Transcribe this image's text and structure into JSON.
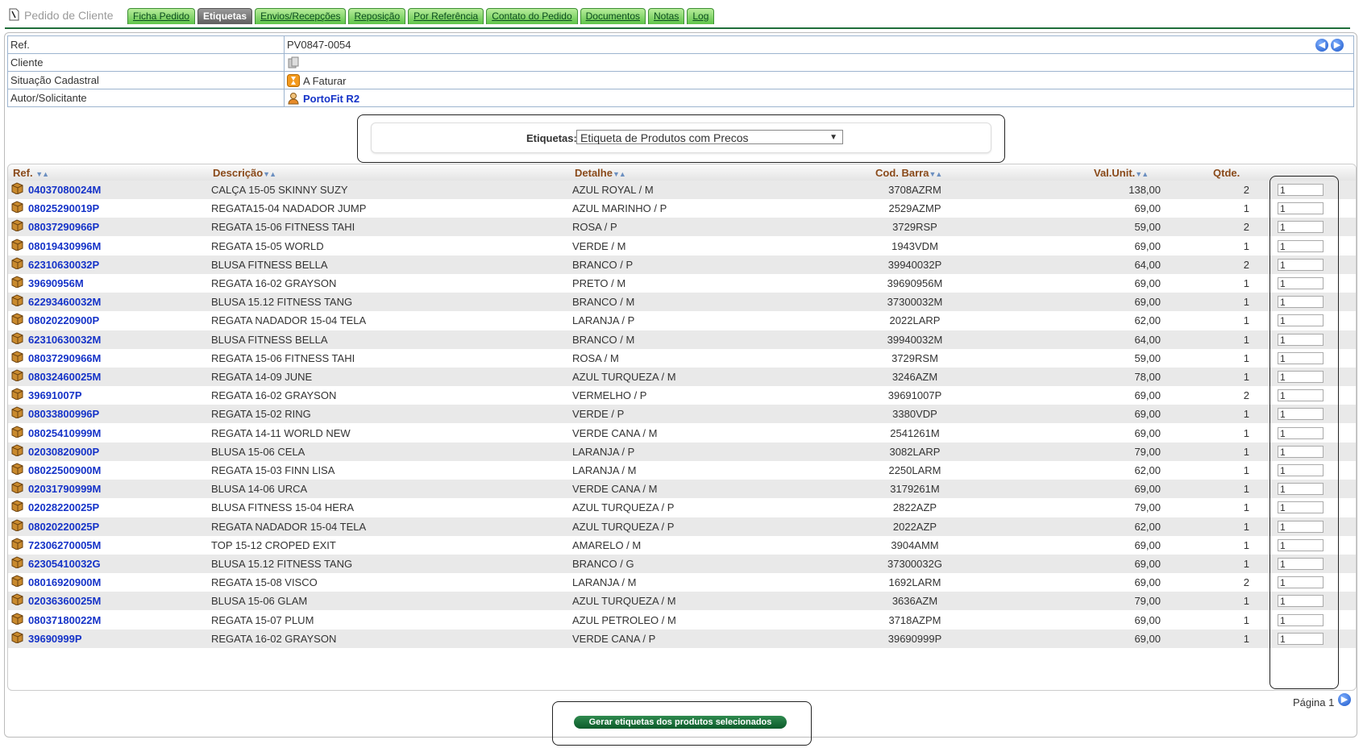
{
  "app": {
    "title": "Pedido de Cliente"
  },
  "tabs": [
    {
      "label": "Ficha Pedido",
      "active": false
    },
    {
      "label": "Etiquetas",
      "active": true
    },
    {
      "label": "Envios/Recepções",
      "active": false
    },
    {
      "label": "Reposição",
      "active": false
    },
    {
      "label": "Por Referência",
      "active": false
    },
    {
      "label": "Contato do Pedido",
      "active": false
    },
    {
      "label": "Documentos",
      "active": false
    },
    {
      "label": "Notas",
      "active": false
    },
    {
      "label": "Log",
      "active": false
    }
  ],
  "info": {
    "ref_label": "Ref.",
    "ref_value": "PV0847-0054",
    "cliente_label": "Cliente",
    "cliente_icon": "client-icon",
    "situacao_label": "Situação Cadastral",
    "situacao_value": "A Faturar",
    "situacao_icon": "hourglass-icon",
    "autor_label": "Autor/Solicitante",
    "autor_value": "PortoFit R2",
    "autor_icon": "user-icon"
  },
  "etiquetas": {
    "label": "Etiquetas:",
    "selected": "Etiqueta de Produtos com Precos"
  },
  "table": {
    "headers": {
      "ref": "Ref.",
      "descricao": "Descrição",
      "detalhe": "Detalhe",
      "cod_barra": "Cod. Barra",
      "val_unit": "Val.Unit.",
      "qtde": "Qtde."
    },
    "rows": [
      {
        "ref": "04037080024M",
        "desc": "CALÇA 15-05 SKINNY SUZY",
        "det": "AZUL ROYAL / M",
        "cod": "3708AZRM",
        "val": "138,00",
        "qtd": "2",
        "input": "1"
      },
      {
        "ref": "08025290019P",
        "desc": "REGATA15-04 NADADOR JUMP",
        "det": "AZUL MARINHO / P",
        "cod": "2529AZMP",
        "val": "69,00",
        "qtd": "1",
        "input": "1"
      },
      {
        "ref": "08037290966P",
        "desc": "REGATA 15-06 FITNESS TAHI",
        "det": "ROSA / P",
        "cod": "3729RSP",
        "val": "59,00",
        "qtd": "2",
        "input": "1"
      },
      {
        "ref": "08019430996M",
        "desc": "REGATA 15-05 WORLD",
        "det": "VERDE / M",
        "cod": "1943VDM",
        "val": "69,00",
        "qtd": "1",
        "input": "1"
      },
      {
        "ref": "62310630032P",
        "desc": "BLUSA FITNESS BELLA",
        "det": "BRANCO / P",
        "cod": "39940032P",
        "val": "64,00",
        "qtd": "2",
        "input": "1"
      },
      {
        "ref": "39690956M",
        "desc": "REGATA 16-02 GRAYSON",
        "det": "PRETO / M",
        "cod": "39690956M",
        "val": "69,00",
        "qtd": "1",
        "input": "1"
      },
      {
        "ref": "62293460032M",
        "desc": "BLUSA 15.12 FITNESS TANG",
        "det": "BRANCO / M",
        "cod": "37300032M",
        "val": "69,00",
        "qtd": "1",
        "input": "1"
      },
      {
        "ref": "08020220900P",
        "desc": "REGATA NADADOR 15-04 TELA",
        "det": "LARANJA / P",
        "cod": "2022LARP",
        "val": "62,00",
        "qtd": "1",
        "input": "1"
      },
      {
        "ref": "62310630032M",
        "desc": "BLUSA FITNESS BELLA",
        "det": "BRANCO / M",
        "cod": "39940032M",
        "val": "64,00",
        "qtd": "1",
        "input": "1"
      },
      {
        "ref": "08037290966M",
        "desc": "REGATA 15-06 FITNESS TAHI",
        "det": "ROSA / M",
        "cod": "3729RSM",
        "val": "59,00",
        "qtd": "1",
        "input": "1"
      },
      {
        "ref": "08032460025M",
        "desc": "REGATA 14-09 JUNE",
        "det": "AZUL TURQUEZA / M",
        "cod": "3246AZM",
        "val": "78,00",
        "qtd": "1",
        "input": "1"
      },
      {
        "ref": "39691007P",
        "desc": "REGATA 16-02 GRAYSON",
        "det": "VERMELHO / P",
        "cod": "39691007P",
        "val": "69,00",
        "qtd": "2",
        "input": "1"
      },
      {
        "ref": "08033800996P",
        "desc": "REGATA 15-02 RING",
        "det": "VERDE / P",
        "cod": "3380VDP",
        "val": "69,00",
        "qtd": "1",
        "input": "1"
      },
      {
        "ref": "08025410999M",
        "desc": "REGATA 14-11 WORLD NEW",
        "det": "VERDE CANA / M",
        "cod": "2541261M",
        "val": "69,00",
        "qtd": "1",
        "input": "1"
      },
      {
        "ref": "02030820900P",
        "desc": "BLUSA 15-06 CELA",
        "det": "LARANJA / P",
        "cod": "3082LARP",
        "val": "79,00",
        "qtd": "1",
        "input": "1"
      },
      {
        "ref": "08022500900M",
        "desc": "REGATA 15-03 FINN LISA",
        "det": "LARANJA / M",
        "cod": "2250LARM",
        "val": "62,00",
        "qtd": "1",
        "input": "1"
      },
      {
        "ref": "02031790999M",
        "desc": "BLUSA 14-06 URCA",
        "det": "VERDE CANA / M",
        "cod": "3179261M",
        "val": "69,00",
        "qtd": "1",
        "input": "1"
      },
      {
        "ref": "02028220025P",
        "desc": "BLUSA FITNESS 15-04 HERA",
        "det": "AZUL TURQUEZA / P",
        "cod": "2822AZP",
        "val": "79,00",
        "qtd": "1",
        "input": "1"
      },
      {
        "ref": "08020220025P",
        "desc": "REGATA NADADOR 15-04 TELA",
        "det": "AZUL TURQUEZA / P",
        "cod": "2022AZP",
        "val": "62,00",
        "qtd": "1",
        "input": "1"
      },
      {
        "ref": "72306270005M",
        "desc": "TOP 15-12 CROPED EXIT",
        "det": "AMARELO / M",
        "cod": "3904AMM",
        "val": "69,00",
        "qtd": "1",
        "input": "1"
      },
      {
        "ref": "62305410032G",
        "desc": "BLUSA 15.12 FITNESS TANG",
        "det": "BRANCO / G",
        "cod": "37300032G",
        "val": "69,00",
        "qtd": "1",
        "input": "1"
      },
      {
        "ref": "08016920900M",
        "desc": "REGATA 15-08 VISCO",
        "det": "LARANJA / M",
        "cod": "1692LARM",
        "val": "69,00",
        "qtd": "2",
        "input": "1"
      },
      {
        "ref": "02036360025M",
        "desc": "BLUSA 15-06 GLAM",
        "det": "AZUL TURQUEZA / M",
        "cod": "3636AZM",
        "val": "79,00",
        "qtd": "1",
        "input": "1"
      },
      {
        "ref": "08037180022M",
        "desc": "REGATA 15-07 PLUM",
        "det": "AZUL PETROLEO / M",
        "cod": "3718AZPM",
        "val": "69,00",
        "qtd": "1",
        "input": "1"
      },
      {
        "ref": "39690999P",
        "desc": "REGATA 16-02 GRAYSON",
        "det": "VERDE CANA / P",
        "cod": "39690999P",
        "val": "69,00",
        "qtd": "1",
        "input": "1"
      }
    ]
  },
  "pager": {
    "label": "Página 1"
  },
  "actions": {
    "generate_label": "Gerar etiquetas dos produtos selecionados"
  },
  "colors": {
    "tab_green": "#5fc44a",
    "header_brown": "#8a4a1a",
    "link_blue": "#1533c8",
    "button_green": "#0c5a2a"
  }
}
